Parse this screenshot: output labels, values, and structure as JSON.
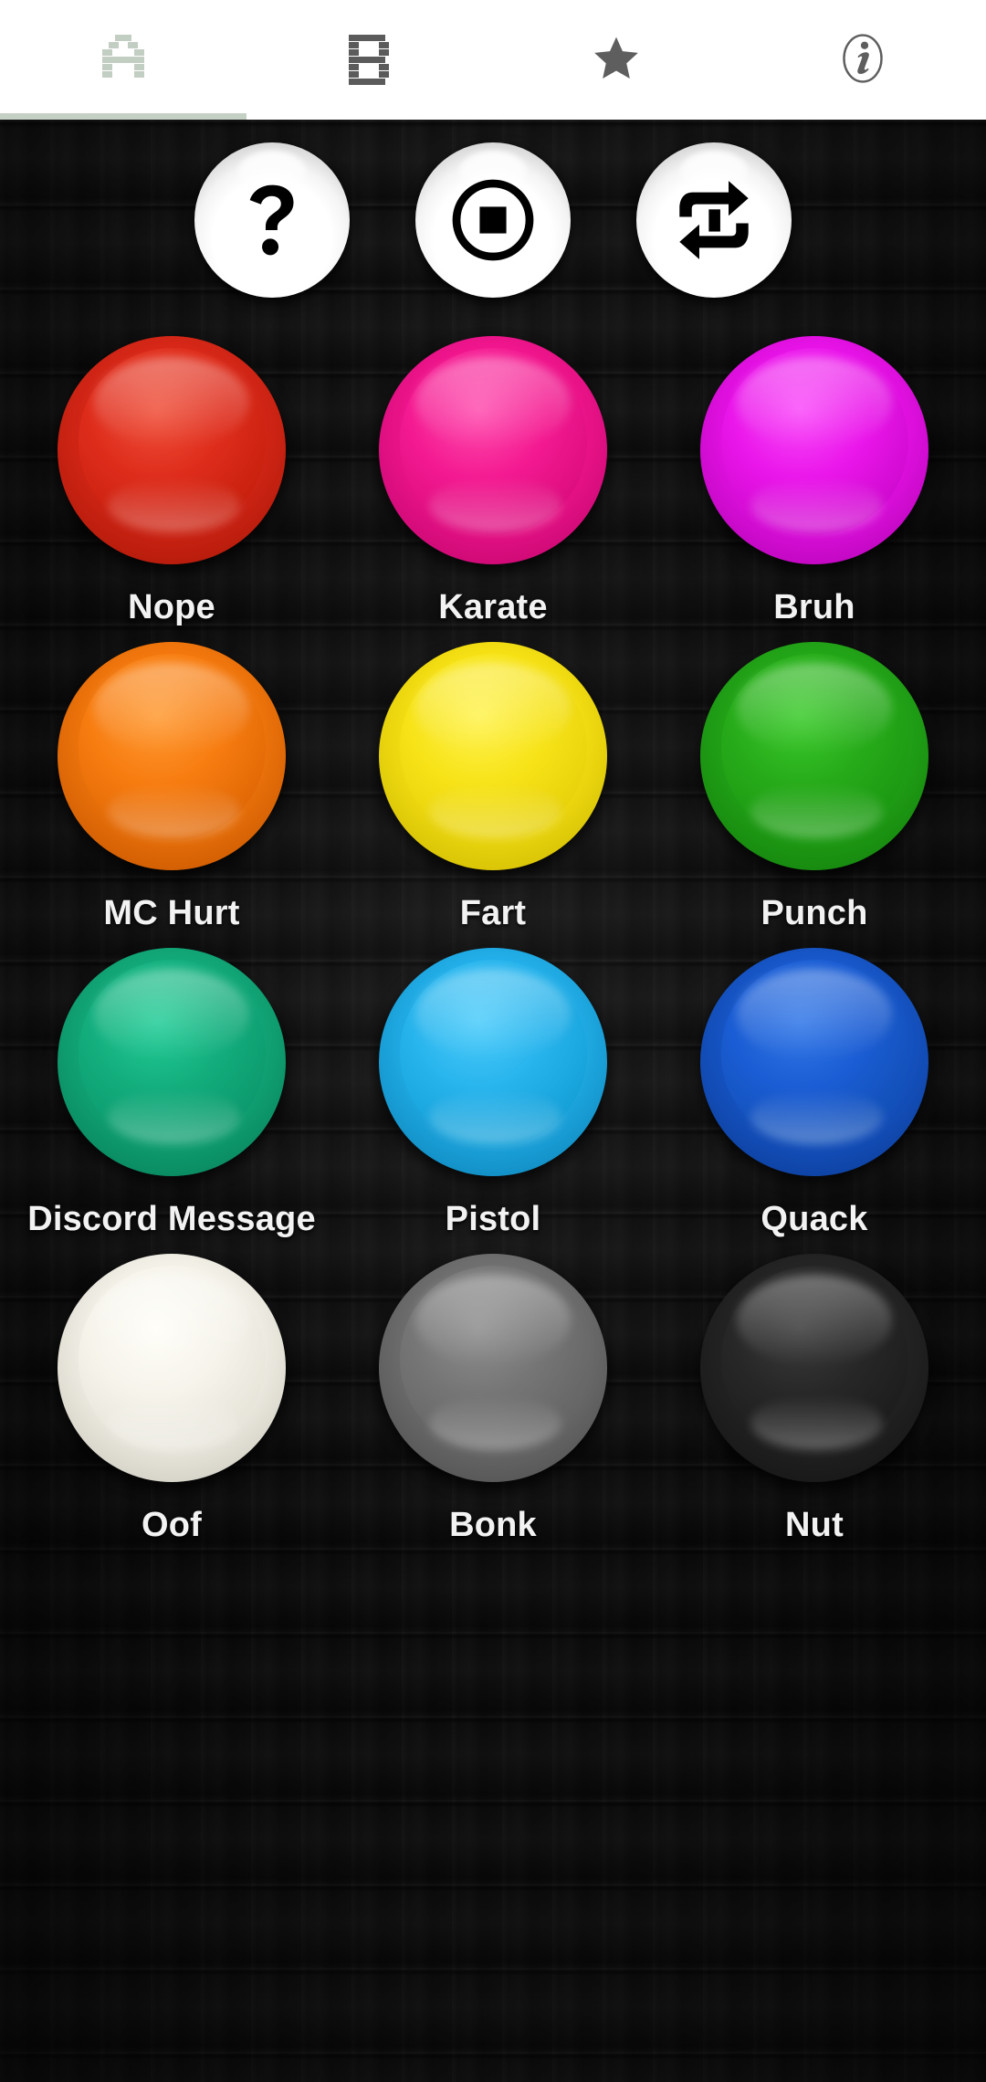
{
  "tabs": [
    {
      "id": "tab-a",
      "icon": "pixel-letter-a-icon",
      "label": "A",
      "active": true
    },
    {
      "id": "tab-b",
      "icon": "pixel-letter-b-icon",
      "label": "B",
      "active": false
    },
    {
      "id": "tab-fav",
      "icon": "star-icon",
      "label": "Favorites",
      "active": false
    },
    {
      "id": "tab-info",
      "icon": "info-icon",
      "label": "Info",
      "active": false
    }
  ],
  "tab_indicator_color": "#c5d0c5",
  "controls": [
    {
      "id": "help-button",
      "icon": "question-mark-icon",
      "label": "Help"
    },
    {
      "id": "stop-button",
      "icon": "stop-circle-icon",
      "label": "Stop"
    },
    {
      "id": "repeat-button",
      "icon": "repeat-one-icon",
      "label": "Repeat One"
    }
  ],
  "sounds": [
    {
      "label": "Nope",
      "color": "#d62718",
      "rim": "#c5200f"
    },
    {
      "label": "Karate",
      "color": "#f0158c",
      "rim": "#d90f7d"
    },
    {
      "label": "Bruh",
      "color": "#e612e6",
      "rim": "#c90dc9"
    },
    {
      "label": "MC Hurt",
      "color": "#f2770d",
      "rim": "#db6405"
    },
    {
      "label": "Fart",
      "color": "#f5e014",
      "rim": "#ddc806"
    },
    {
      "label": "Punch",
      "color": "#23a518",
      "rim": "#1b8f12"
    },
    {
      "label": "Discord Message",
      "color": "#12a878",
      "rim": "#0c926a"
    },
    {
      "label": "Pistol",
      "color": "#22aee8",
      "rim": "#1598d2"
    },
    {
      "label": "Quack",
      "color": "#1757c9",
      "rim": "#1149ad"
    },
    {
      "label": "Oof",
      "color": "#f3f1e7",
      "rim": "#dddbd1"
    },
    {
      "label": "Bonk",
      "color": "#6f6f6f",
      "rim": "#616161"
    },
    {
      "label": "Nut",
      "color": "#242424",
      "rim": "#1a1a1a"
    }
  ],
  "background": {
    "theme": "dark-wood-planks",
    "base_color": "#0f0f0f"
  }
}
